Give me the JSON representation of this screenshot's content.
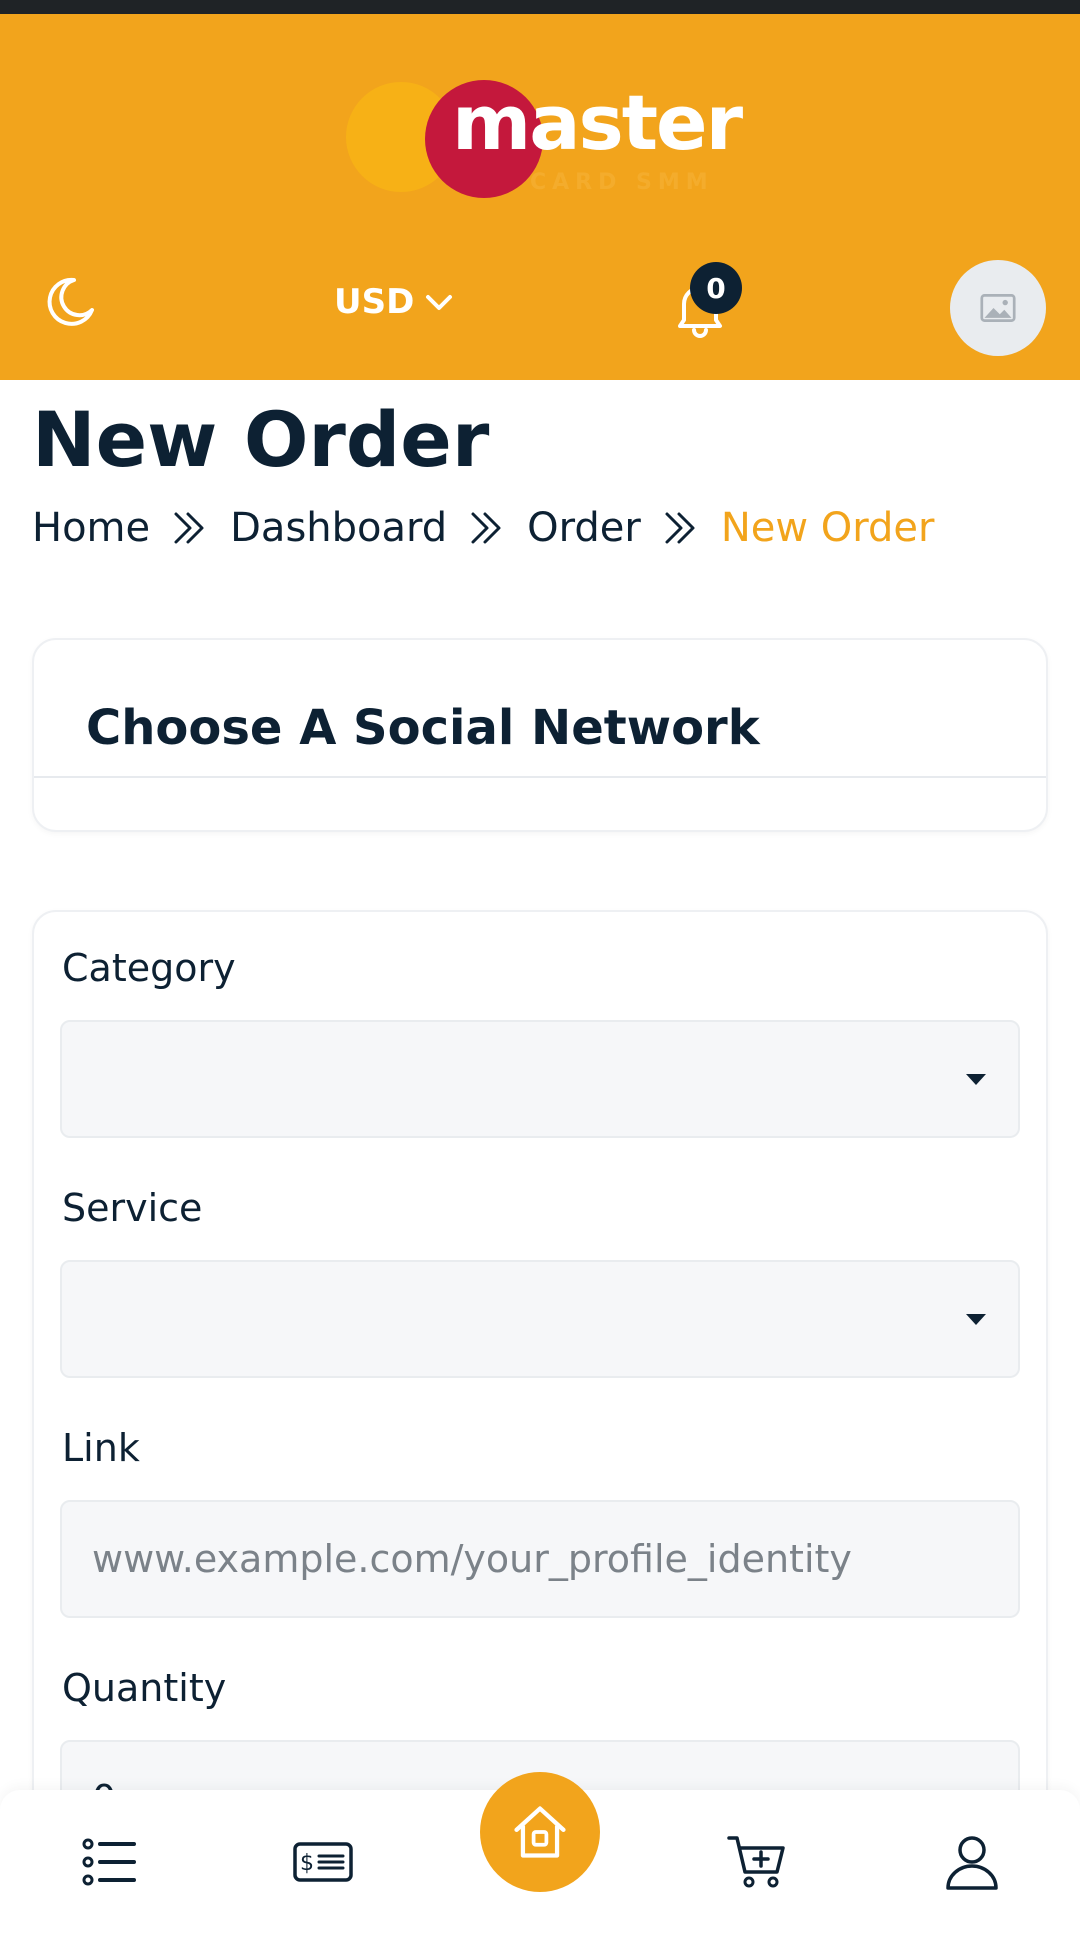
{
  "header": {
    "logo_text": "master",
    "logo_subtext": "CARD SMM",
    "currency": "USD",
    "notification_count": "0"
  },
  "page": {
    "title": "New Order"
  },
  "breadcrumb": {
    "items": [
      "Home",
      "Dashboard",
      "Order",
      "New Order"
    ]
  },
  "social_card": {
    "title": "Choose A Social Network"
  },
  "form": {
    "category_label": "Category",
    "category_value": "",
    "service_label": "Service",
    "service_value": "",
    "link_label": "Link",
    "link_placeholder": "www.example.com/your_profile_identity",
    "quantity_label": "Quantity",
    "quantity_value": "0"
  },
  "bottom_nav": {
    "icons": [
      "list-icon",
      "money-bill-icon",
      "home-icon",
      "cart-plus-icon",
      "user-icon"
    ]
  },
  "colors": {
    "accent": "#f2a41c",
    "dark": "#0d2133",
    "logo_red": "#c4183c"
  }
}
